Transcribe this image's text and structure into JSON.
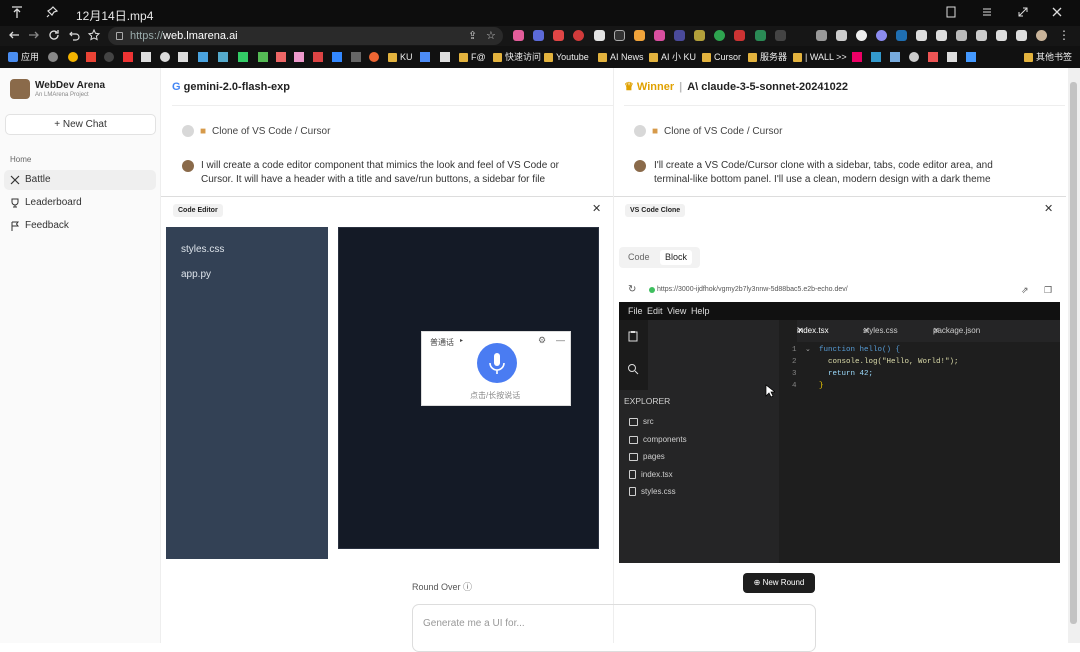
{
  "window": {
    "tab_title": "12月14日.mp4"
  },
  "browser": {
    "url_prefix": "https://",
    "url_domain": "web.lmarena.ai"
  },
  "bookmarks": [
    "应用",
    "KU",
    "F@",
    "快速访问",
    "Youtube",
    "AI News",
    "AI 小 KU",
    "Cursor",
    "服务器",
    "| WALL >>",
    "其他书签"
  ],
  "sidebar": {
    "app_name": "WebDev Arena",
    "subtitle": "An LMArena Project",
    "new_chat": "New Chat",
    "section": "Home",
    "items": [
      "Battle",
      "Leaderboard",
      "Feedback"
    ]
  },
  "left": {
    "model": "gemini-2.0-flash-exp",
    "prompt": "Clone of VS Code / Cursor",
    "response": "I will create a code editor component that mimics the look and feel of VS Code or Cursor. It will have a header with a title and save/run buttons, a sidebar for file",
    "panel_title": "Code Editor",
    "files": [
      "styles.css",
      "app.py"
    ],
    "voice": {
      "mode": "普通话",
      "hint": "点击/长按说话"
    }
  },
  "right": {
    "winner": "Winner",
    "model": "claude-3-5-sonnet-20241022",
    "prompt": "Clone of VS Code / Cursor",
    "response": "I'll create a VS Code/Cursor clone with a sidebar, tabs, code editor area, and terminal-like bottom panel. I'll use a clean, modern design with a dark theme",
    "panel_title": "VS Code Clone",
    "tabs": [
      "Code",
      "Block"
    ],
    "preview_url": "https://3000-ijdfhok/vgmy2b7ly3nnw-5d88bac5.e2b-echo.dev/",
    "vscode": {
      "menu": [
        "File",
        "Edit",
        "View",
        "Help"
      ],
      "explorer": "EXPLORER",
      "tree": [
        {
          "name": "src",
          "kind": "folder"
        },
        {
          "name": "components",
          "kind": "folder"
        },
        {
          "name": "pages",
          "kind": "folder"
        },
        {
          "name": "index.tsx",
          "kind": "file"
        },
        {
          "name": "styles.css",
          "kind": "file"
        }
      ],
      "tabs": [
        "index.tsx",
        "styles.css",
        "package.json"
      ],
      "code": [
        {
          "n": "1",
          "t": "function hello() {"
        },
        {
          "n": "2",
          "t": "  console.log(\"Hello, World!\");"
        },
        {
          "n": "3",
          "t": "  return 42;"
        },
        {
          "n": "4",
          "t": "}"
        }
      ]
    }
  },
  "footer": {
    "round_over": "Round Over",
    "new_round": "New Round",
    "input_placeholder": "Generate me a UI for..."
  },
  "colors": {
    "winner": "#e0a100",
    "dark": "#1e1e1e",
    "sidebar_slate": "#334155"
  }
}
